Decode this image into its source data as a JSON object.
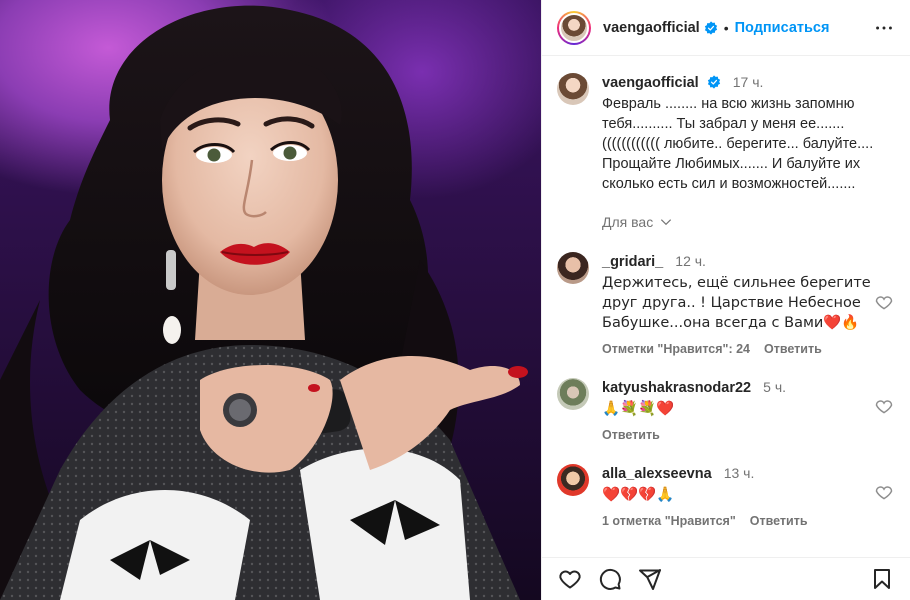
{
  "header": {
    "username": "vaengaofficial",
    "dot": "•",
    "follow_label": "Подписаться"
  },
  "caption": {
    "username": "vaengaofficial",
    "time": "17 ч.",
    "text": "Февраль ........ на всю жизнь запомню тебя.......... Ты забрал у меня ее....... (((((((((((( любите.. берегите... балуйте.... Прощайте Любимых....... И балуйте их сколько есть сил и возможностей.......",
    "translate_label": "Для вас"
  },
  "comments": [
    {
      "username": "_gridari_",
      "time": "12 ч.",
      "text": "Держитесь, ещё сильнее берегите друг друга.. ! Царствие Небесное Бабушке...она всегда с Вами❤️🔥",
      "likes": "Отметки \"Нравится\": 24",
      "reply": "Ответить"
    },
    {
      "username": "katyushakrasnodar22",
      "time": "5 ч.",
      "text": "🙏💐💐❤️",
      "reply": "Ответить"
    },
    {
      "username": "alla_alexseevna",
      "time": "13 ч.",
      "text": "❤️💔💔🙏",
      "likes": "1 отметка \"Нравится\"",
      "reply": "Ответить"
    }
  ],
  "icons": {
    "verified_color": "#0095f6",
    "accent": "#0095f6"
  }
}
